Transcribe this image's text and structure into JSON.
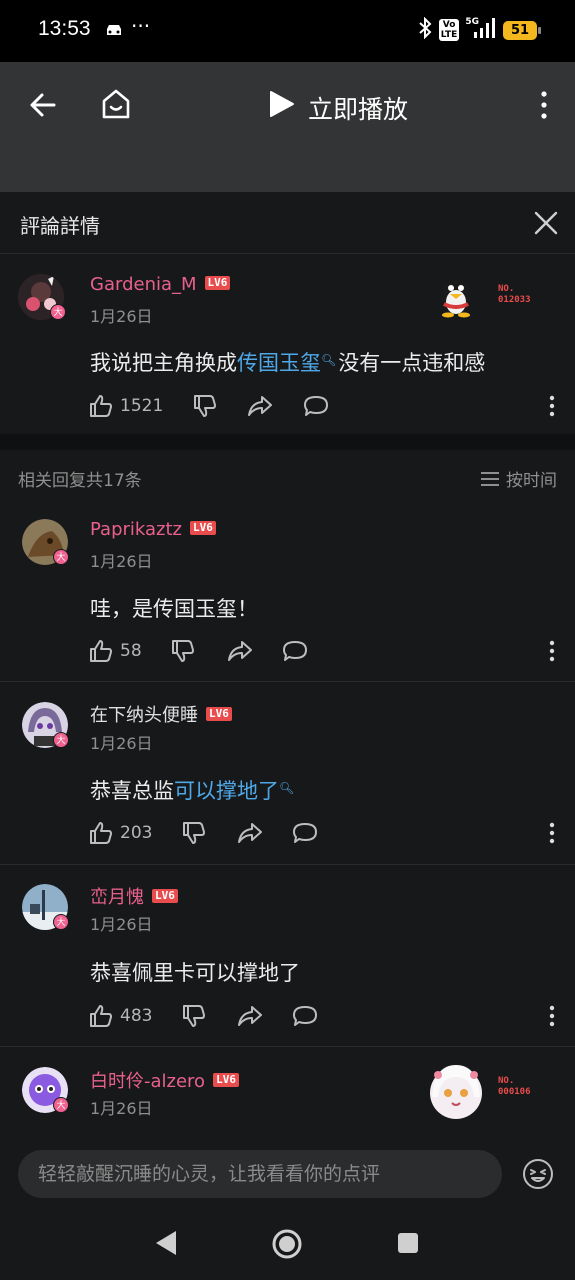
{
  "status_bar": {
    "time": "13:53",
    "more": "···",
    "volte": "Vo\nLTE",
    "network": "5G",
    "battery": "51"
  },
  "header": {
    "play_label": "立即播放"
  },
  "detail": {
    "title": "評論詳情"
  },
  "main_comment": {
    "username": "Gardenia_M",
    "level": "LV6",
    "date": "1月26日",
    "text_before": "我说把主角换成",
    "link": "传国玉玺",
    "text_after": "没有一点违和感",
    "likes": "1521",
    "fan_no_label": "NO.",
    "fan_no": "012033",
    "avatar_badge": "大"
  },
  "replies_header": {
    "count": "相关回复共17条",
    "sort": "按时间"
  },
  "replies": [
    {
      "username": "Paprikaztz",
      "level": "LV6",
      "date": "1月26日",
      "text": "哇，是传国玉玺！",
      "likes": "58",
      "badge": "大"
    },
    {
      "username": "在下纳头便睡",
      "level": "LV6",
      "date": "1月26日",
      "text_before": "恭喜总监",
      "link": "可以撑地了",
      "likes": "203",
      "badge": "大"
    },
    {
      "username": "峦月愧",
      "level": "LV6",
      "date": "1月26日",
      "text": "恭喜佩里卡可以撑地了",
      "likes": "483",
      "badge": "大"
    },
    {
      "username": "白时伶-alzero",
      "level": "LV6",
      "date": "1月26日",
      "fan_no_label": "NO.",
      "fan_no": "000106",
      "badge": "大"
    }
  ],
  "input": {
    "placeholder": "轻轻敲醒沉睡的心灵，让我看看你的点评"
  },
  "colors": {
    "accent_pink": "#e8608b",
    "link_blue": "#4fa8e8",
    "level_red": "#e84c4c",
    "bg": "#17181a"
  }
}
